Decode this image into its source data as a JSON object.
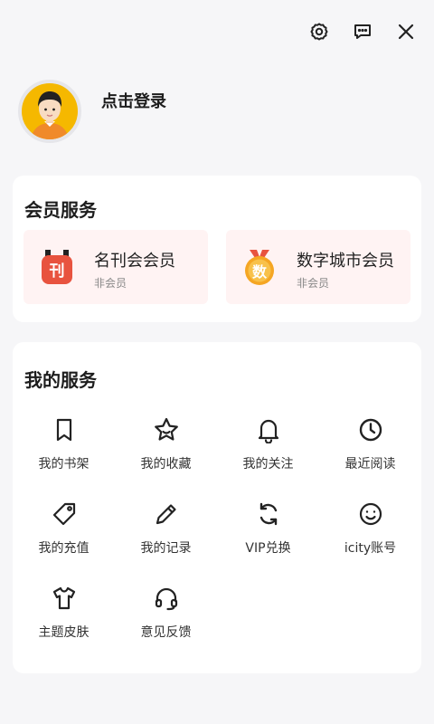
{
  "header": {
    "icons": [
      "settings-icon",
      "message-icon",
      "close-icon"
    ]
  },
  "profile": {
    "login_label": "点击登录"
  },
  "membership": {
    "title": "会员服务",
    "items": [
      {
        "name": "名刊会会员",
        "status": "非会员",
        "badge_text": "刊",
        "badge_color": "#e8533f"
      },
      {
        "name": "数字城市会员",
        "status": "非会员",
        "badge_text": "数",
        "badge_color": "#f5a623"
      }
    ]
  },
  "services": {
    "title": "我的服务",
    "items": [
      {
        "label": "我的书架",
        "icon": "bookmark-icon"
      },
      {
        "label": "我的收藏",
        "icon": "star-icon"
      },
      {
        "label": "我的关注",
        "icon": "bell-icon"
      },
      {
        "label": "最近阅读",
        "icon": "clock-icon"
      },
      {
        "label": "我的充值",
        "icon": "tag-icon"
      },
      {
        "label": "我的记录",
        "icon": "pencil-icon"
      },
      {
        "label": "VIP兑换",
        "icon": "refresh-icon"
      },
      {
        "label": "icity账号",
        "icon": "smiley-icon"
      },
      {
        "label": "主题皮肤",
        "icon": "tshirt-icon"
      },
      {
        "label": "意见反馈",
        "icon": "headset-icon"
      }
    ]
  },
  "colors": {
    "background": "#f6f6f8",
    "card": "#ffffff",
    "member_item_bg": "#fff3f3",
    "avatar_bg": "#f5b800"
  }
}
